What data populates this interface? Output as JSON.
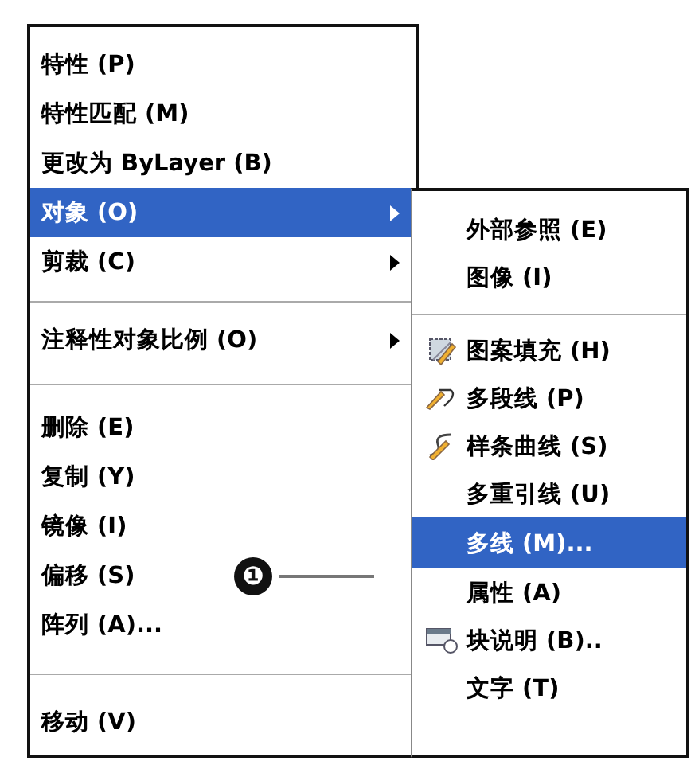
{
  "context_menu": {
    "items": [
      {
        "kind": "item",
        "label": "特性 (P)",
        "selected": false,
        "submenu": false
      },
      {
        "kind": "item",
        "label": "特性匹配 (M)",
        "selected": false,
        "submenu": false
      },
      {
        "kind": "item",
        "label": "更改为 ByLayer (B)",
        "selected": false,
        "submenu": false
      },
      {
        "kind": "item",
        "label": "对象 (O)",
        "selected": true,
        "submenu": true
      },
      {
        "kind": "item",
        "label": "剪裁 (C)",
        "selected": false,
        "submenu": true
      },
      {
        "kind": "separator"
      },
      {
        "kind": "item",
        "label": "注释性对象比例 (O)",
        "selected": false,
        "submenu": true
      },
      {
        "kind": "separator"
      },
      {
        "kind": "item",
        "label": "删除 (E)",
        "selected": false,
        "submenu": false
      },
      {
        "kind": "item",
        "label": "复制 (Y)",
        "selected": false,
        "submenu": false
      },
      {
        "kind": "item",
        "label": "镜像 (I)",
        "selected": false,
        "submenu": false
      },
      {
        "kind": "item",
        "label": "偏移 (S)",
        "selected": false,
        "submenu": false
      },
      {
        "kind": "item",
        "label": "阵列 (A)...",
        "selected": false,
        "submenu": false
      },
      {
        "kind": "separator"
      },
      {
        "kind": "item",
        "label": "移动 (V)",
        "selected": false,
        "submenu": false
      }
    ]
  },
  "submenu": {
    "items": [
      {
        "kind": "item",
        "label": "外部参照 (E)",
        "selected": false
      },
      {
        "kind": "item",
        "label": "图像 (I)",
        "selected": false
      },
      {
        "kind": "separator"
      },
      {
        "kind": "item",
        "label": "图案填充 (H)",
        "selected": false
      },
      {
        "kind": "item",
        "label": "多段线 (P)",
        "selected": false
      },
      {
        "kind": "item",
        "label": "样条曲线 (S)",
        "selected": false
      },
      {
        "kind": "item",
        "label": "多重引线 (U)",
        "selected": false
      },
      {
        "kind": "item",
        "label": "多线 (M)...",
        "selected": true
      },
      {
        "kind": "item",
        "label": "属性 (A)",
        "selected": false
      },
      {
        "kind": "item",
        "label": "块说明 (B)..",
        "selected": false
      },
      {
        "kind": "item",
        "label": "文字 (T)",
        "selected": false
      }
    ]
  },
  "callout": {
    "label": "❶"
  }
}
